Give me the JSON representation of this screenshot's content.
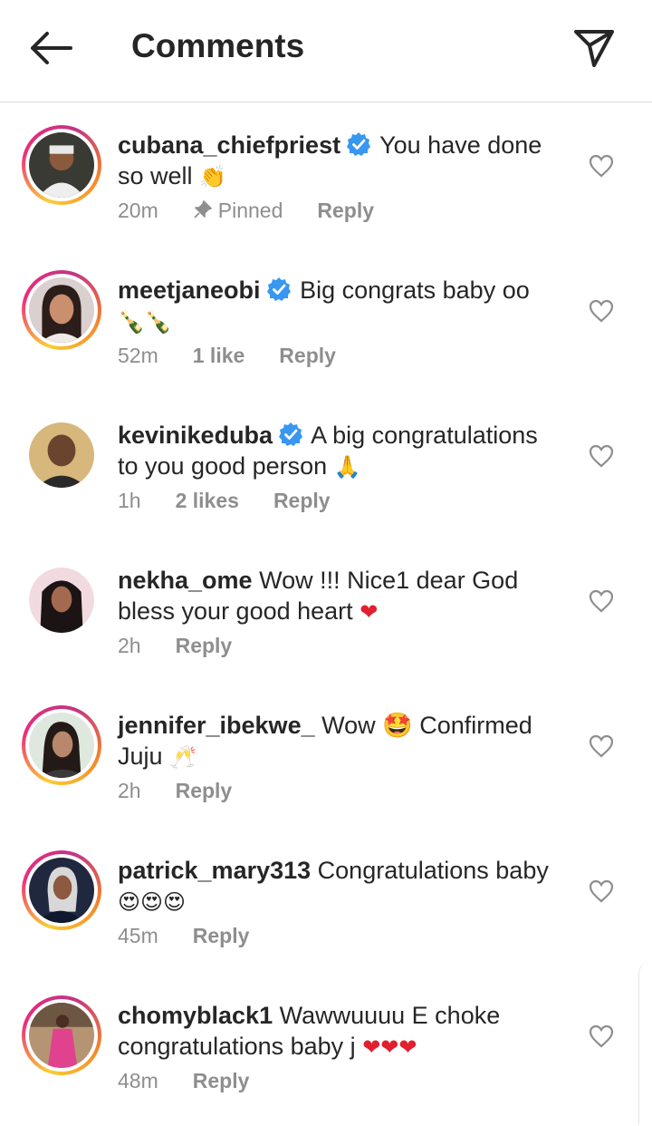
{
  "header": {
    "title": "Comments",
    "back_icon": "arrow-left-icon",
    "share_icon": "paper-plane-icon"
  },
  "colors": {
    "verified": "#3897f0",
    "meta": "#8e8e8e",
    "divider": "#dbdbdb",
    "text": "#262626"
  },
  "comments": [
    {
      "username": "cubana_chiefpriest",
      "verified": true,
      "text": "You have done so well",
      "emoji": "👏",
      "time": "20m",
      "likes": "",
      "pinned": "Pinned",
      "reply": "Reply",
      "story_ring": true
    },
    {
      "username": "meetjaneobi",
      "verified": true,
      "text": "Big congrats baby oo",
      "emoji": "🍾🍾",
      "time": "52m",
      "likes": "1 like",
      "pinned": "",
      "reply": "Reply",
      "story_ring": true
    },
    {
      "username": "kevinikeduba",
      "verified": true,
      "text": "A big congratulations to you good person",
      "emoji": "🙏",
      "time": "1h",
      "likes": "2 likes",
      "pinned": "",
      "reply": "Reply",
      "story_ring": false
    },
    {
      "username": "nekha_ome",
      "verified": false,
      "text": "Wow !!! Nice1 dear God bless your good heart",
      "emoji": "❤",
      "time": "2h",
      "likes": "",
      "pinned": "",
      "reply": "Reply",
      "story_ring": false
    },
    {
      "username": "jennifer_ibekwe_",
      "verified": false,
      "text": "Wow 🤩 Confirmed Juju",
      "emoji": "🥂",
      "time": "2h",
      "likes": "",
      "pinned": "",
      "reply": "Reply",
      "story_ring": true
    },
    {
      "username": "patrick_mary313",
      "verified": false,
      "text": "Congratulations baby",
      "emoji": "😍😍😍",
      "time": "45m",
      "likes": "",
      "pinned": "",
      "reply": "Reply",
      "story_ring": true
    },
    {
      "username": "chomyblack1",
      "verified": false,
      "text": "Wawwuuuu E choke congratulations baby j",
      "emoji": "❤❤❤",
      "time": "48m",
      "likes": "",
      "pinned": "",
      "reply": "Reply",
      "story_ring": true
    }
  ]
}
